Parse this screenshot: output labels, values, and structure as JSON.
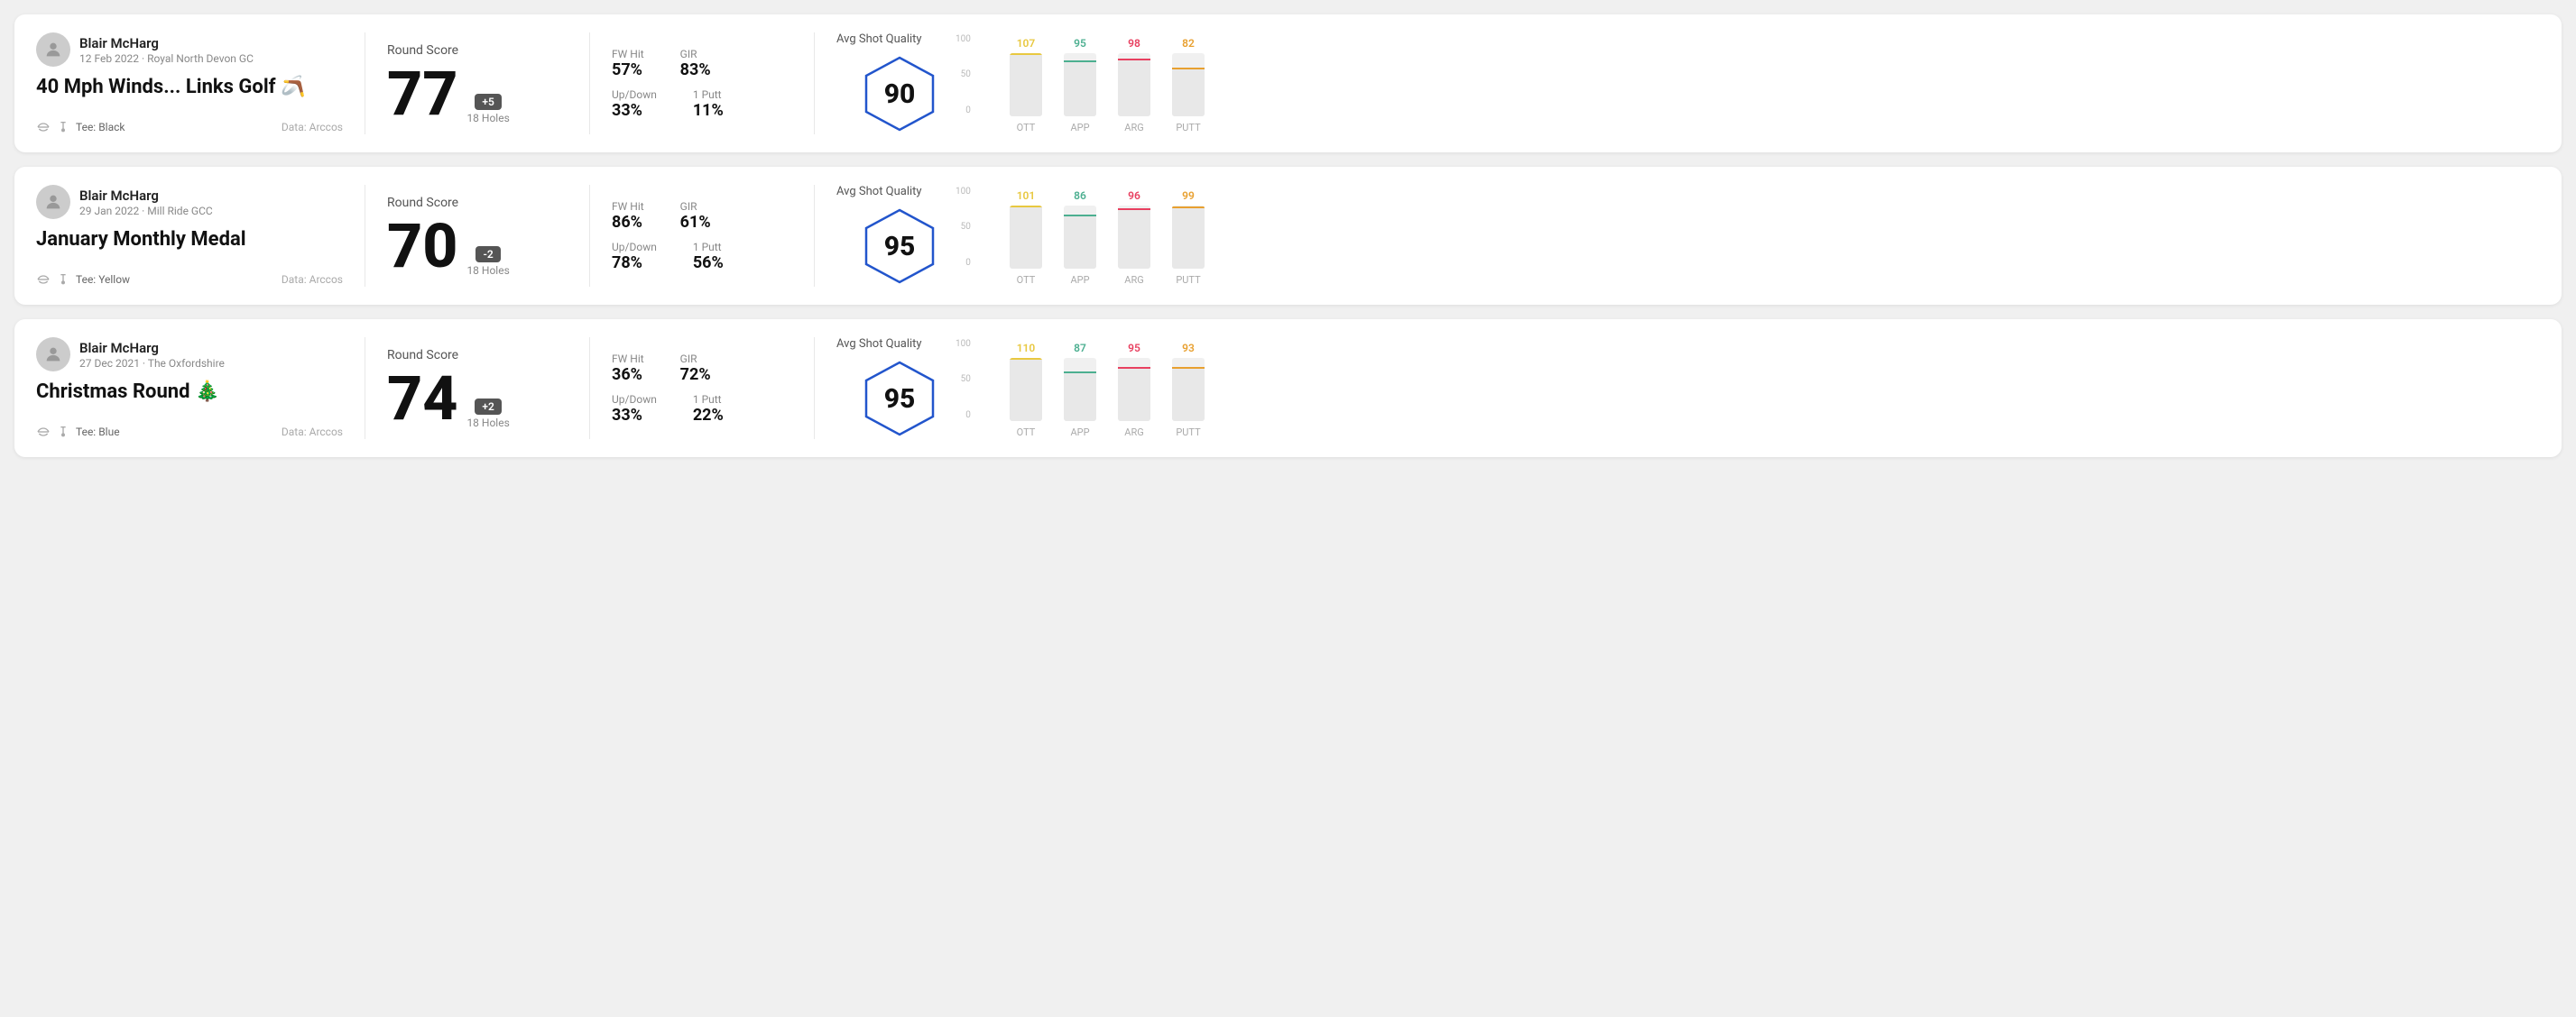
{
  "rounds": [
    {
      "id": "round1",
      "user": {
        "name": "Blair McHarg",
        "date": "12 Feb 2022 · Royal North Devon GC"
      },
      "title": "40 Mph Winds... Links Golf 🪃",
      "tee": "Black",
      "data_source": "Data: Arccos",
      "score": {
        "value": "77",
        "badge": "+5",
        "holes": "18 Holes"
      },
      "stats": {
        "fw_hit_label": "FW Hit",
        "fw_hit_value": "57%",
        "gir_label": "GIR",
        "gir_value": "83%",
        "updown_label": "Up/Down",
        "updown_value": "33%",
        "putt_label": "1 Putt",
        "putt_value": "11%"
      },
      "quality": {
        "label": "Avg Shot Quality",
        "score": "90"
      },
      "chart": {
        "bars": [
          {
            "label": "OTT",
            "value": 107,
            "color": "#e8c840",
            "pct": 100
          },
          {
            "label": "APP",
            "value": 95,
            "color": "#4caf90",
            "pct": 89
          },
          {
            "label": "ARG",
            "value": 98,
            "color": "#e84060",
            "pct": 92
          },
          {
            "label": "PUTT",
            "value": 82,
            "color": "#e8a030",
            "pct": 77
          }
        ],
        "y_labels": [
          "100",
          "50",
          "0"
        ]
      }
    },
    {
      "id": "round2",
      "user": {
        "name": "Blair McHarg",
        "date": "29 Jan 2022 · Mill Ride GCC"
      },
      "title": "January Monthly Medal",
      "tee": "Yellow",
      "data_source": "Data: Arccos",
      "score": {
        "value": "70",
        "badge": "-2",
        "holes": "18 Holes"
      },
      "stats": {
        "fw_hit_label": "FW Hit",
        "fw_hit_value": "86%",
        "gir_label": "GIR",
        "gir_value": "61%",
        "updown_label": "Up/Down",
        "updown_value": "78%",
        "putt_label": "1 Putt",
        "putt_value": "56%"
      },
      "quality": {
        "label": "Avg Shot Quality",
        "score": "95"
      },
      "chart": {
        "bars": [
          {
            "label": "OTT",
            "value": 101,
            "color": "#e8c840",
            "pct": 100
          },
          {
            "label": "APP",
            "value": 86,
            "color": "#4caf90",
            "pct": 85
          },
          {
            "label": "ARG",
            "value": 96,
            "color": "#e84060",
            "pct": 95
          },
          {
            "label": "PUTT",
            "value": 99,
            "color": "#e8a030",
            "pct": 98
          }
        ],
        "y_labels": [
          "100",
          "50",
          "0"
        ]
      }
    },
    {
      "id": "round3",
      "user": {
        "name": "Blair McHarg",
        "date": "27 Dec 2021 · The Oxfordshire"
      },
      "title": "Christmas Round 🎄",
      "tee": "Blue",
      "data_source": "Data: Arccos",
      "score": {
        "value": "74",
        "badge": "+2",
        "holes": "18 Holes"
      },
      "stats": {
        "fw_hit_label": "FW Hit",
        "fw_hit_value": "36%",
        "gir_label": "GIR",
        "gir_value": "72%",
        "updown_label": "Up/Down",
        "updown_value": "33%",
        "putt_label": "1 Putt",
        "putt_value": "22%"
      },
      "quality": {
        "label": "Avg Shot Quality",
        "score": "95"
      },
      "chart": {
        "bars": [
          {
            "label": "OTT",
            "value": 110,
            "color": "#e8c840",
            "pct": 100
          },
          {
            "label": "APP",
            "value": 87,
            "color": "#4caf90",
            "pct": 79
          },
          {
            "label": "ARG",
            "value": 95,
            "color": "#e84060",
            "pct": 86
          },
          {
            "label": "PUTT",
            "value": 93,
            "color": "#e8a030",
            "pct": 85
          }
        ],
        "y_labels": [
          "100",
          "50",
          "0"
        ]
      }
    }
  ],
  "labels": {
    "round_score": "Round Score",
    "avg_shot_quality": "Avg Shot Quality",
    "tee_prefix": "Tee:",
    "data_arccos": "Data: Arccos"
  }
}
